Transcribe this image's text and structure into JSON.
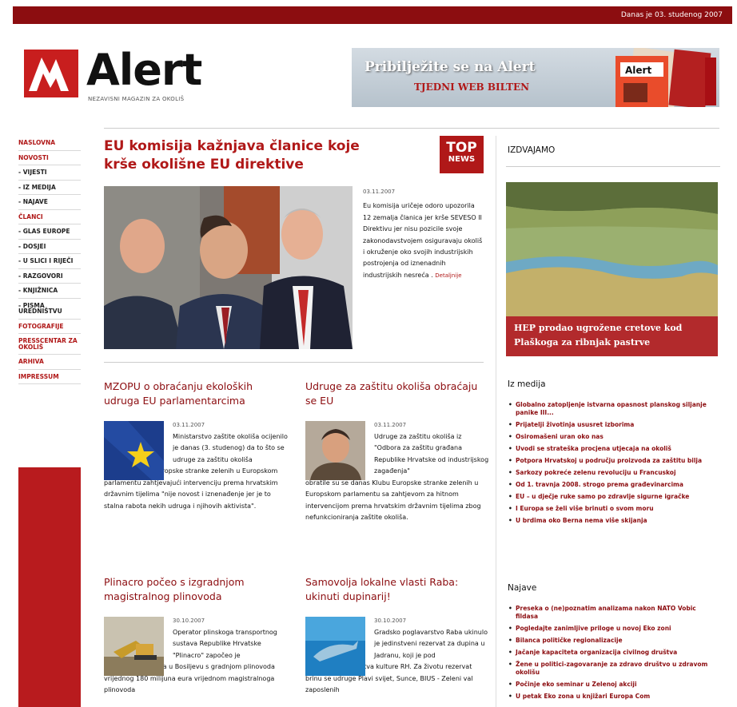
{
  "header": {
    "date_text": "Danas je 03. studenog 2007"
  },
  "logo": {
    "name": "Alert",
    "tagline": "NEZAVISNI MAGAZIN ZA OKOLIŠ"
  },
  "banner": {
    "line1": "Pribilježite se na Alert",
    "line2": "TJEDNI WEB BILTEN",
    "mag_title": "Alert"
  },
  "nav": {
    "items": [
      {
        "label": "NASLOVNA",
        "red": true
      },
      {
        "label": "NOVOSTI",
        "red": true
      },
      {
        "label": "- VIJESTI",
        "red": false
      },
      {
        "label": "- IZ MEDIJA",
        "red": false
      },
      {
        "label": "- NAJAVE",
        "red": false
      },
      {
        "label": "ČLANCI",
        "red": true
      },
      {
        "label": "- GLAS EUROPE",
        "red": false
      },
      {
        "label": "- DOSJEI",
        "red": false
      },
      {
        "label": "- U SLICI I RIJEČI",
        "red": false
      },
      {
        "label": "- RAZGOVORI",
        "red": false
      },
      {
        "label": "- KNJIŽNICA",
        "red": false
      },
      {
        "label": "- PISMA UREDNIŠTVU",
        "red": false
      },
      {
        "label": "FOTOGRAFIJE",
        "red": true
      },
      {
        "label": "PRESSCENTAR ZA OKOLIŠ",
        "red": true
      },
      {
        "label": "ARHIVA",
        "red": true
      },
      {
        "label": "IMPRESSUM",
        "red": true
      }
    ]
  },
  "lead": {
    "title": "EU komisija kažnjava članice koje krše okolišne EU direktive",
    "badge_top": "TOP",
    "badge_bottom": "NEWS",
    "date": "03.11.2007",
    "text": "Eu komisija uričeje odoro upozorila 12 zemalja članica jer krše SEVESO II Direktivu jer nisu pozicile svoje zakonodavstvojem osiguravaju okoliš i okruženje oko svojih industrijskih postrojenja od iznenadnih industrijskih nesreća .",
    "more": "Detaljnije"
  },
  "articles": [
    {
      "title": "MZOPU o obraćanju ekoloških udruga EU parlamentarcima",
      "date": "03.11.2007",
      "text_indent": "Ministarstvo zaštite okoliša ocijenilo je danas (3. studenog) da to što se udruge za zaštitu okoliša",
      "text_full": "obraćaju Klubu Europske stranke zelenih u Europskom parlamentu zahtjevajući intervenciju prema hrvatskim državnim tijelima \"nije novost i iznenađenje jer je to stalna rabota nekih udruga i njihovih aktivista\"."
    },
    {
      "title": "Udruge za zaštitu okoliša obraćaju se EU",
      "date": "03.11.2007",
      "text_indent": "Udruge za zaštitu okoliša iz \"Odbora za zaštitu građana Republike Hrvatske od industrijskog zagađenja\"",
      "text_full": "obratile su se danas Klubu Europske stranke zelenih u Europskom parlamentu sa zahtjevom za hitnom intervencijom prema hrvatskim državnim tijelima zbog nefunkcioniranja zaštite okoliša."
    },
    {
      "title": "Plinacro počeo s izgradnjom magistralnog plinovoda",
      "date": "30.10.2007",
      "text_indent": "Operator plinskoga transportnog sustava Republike Hrvatske \"Plinacro\" započeo je",
      "text_full": "danas 30. listopada u Bosiljevu s gradnjom plinovoda vrijednog 180 milijuna eura vrijednom magistralnoga plinovoda"
    },
    {
      "title": "Samovolja lokalne vlasti Raba: ukinuti dupinarij!",
      "date": "30.10.2007",
      "text_indent": "Gradsko poglavarstvo Raba ukinulo je jedinstveni rezervat za dupina u Jadranu, koji je pod",
      "text_full": "zaštitom Ministarstva kulture RH. Za životu rezervat brinu se udruge Plavi svijet, Sunce, BIUS - Zeleni val zaposlenih"
    }
  ],
  "right": {
    "izdvajamo_label": "IZDVAJAMO",
    "feature_caption": "HEP prodao ugrožene cretove kod Plaškoga za ribnjak pastrve",
    "iz_medija_label": "Iz medija",
    "iz_medija": [
      "Globalno zatopljenje istvarna opasnost planskog siljanje panike III...",
      "Prijatelji životinja ususret izborima",
      "Osiromašeni uran oko nas",
      "Uvodi se strateška procjena utjecaja na okoliš",
      "Potpora Hrvatskoj u području proizvoda za zaštitu bilja",
      "Sarkozy pokreće zelenu revoluciju u Francuskoj",
      "Od 1. travnja 2008. strogo prema građevinarcima",
      "EU – u dječje ruke samo po zdravlje sigurne igračke",
      "I Europa se želi više brinuti o svom moru",
      "U brdima oko Berna nema više skijanja"
    ],
    "najave_label": "Najave",
    "najave": [
      "Preseka o (ne)poznatim analizama nakon NATO Vobic fildasa",
      "Pogledajte zanimljive priloge u novoj Eko zoni",
      "Bilanca političke regionalizacije",
      "Jačanje kapaciteta organizacija civilnog društva",
      "Žene u politici-zagovaranje za zdravo društvo u zdravom okolišu",
      "Počinje eko seminar u Zelenoj akciji",
      "U petak Eko zona u knjižari Europa Com"
    ]
  },
  "colors": {
    "brand_red": "#b01818",
    "dark_red": "#8c0d10",
    "nav_block": "#b81b1e"
  }
}
